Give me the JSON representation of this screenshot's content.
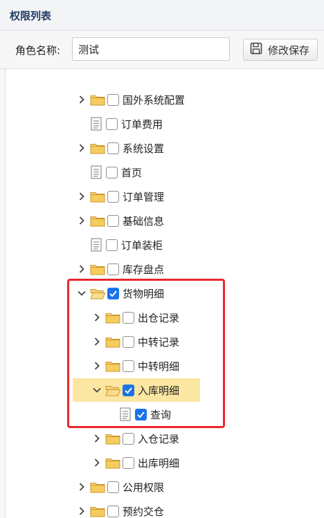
{
  "panel": {
    "title": "权限列表"
  },
  "toolbar": {
    "role_label": "角色名称:",
    "role_value": "测试",
    "save_label": "修改保存"
  },
  "tree": [
    {
      "label": "国外系统配置",
      "kind": "folder",
      "expanded": false,
      "checked": false,
      "level": 0
    },
    {
      "label": "订单费用",
      "kind": "doc",
      "checked": false,
      "level": 0
    },
    {
      "label": "系统设置",
      "kind": "folder",
      "expanded": false,
      "checked": false,
      "level": 0
    },
    {
      "label": "首页",
      "kind": "doc",
      "checked": false,
      "level": 0
    },
    {
      "label": "订单管理",
      "kind": "folder",
      "expanded": false,
      "checked": false,
      "level": 0
    },
    {
      "label": "基础信息",
      "kind": "folder",
      "expanded": false,
      "checked": false,
      "level": 0
    },
    {
      "label": "订单装柜",
      "kind": "doc",
      "checked": false,
      "level": 0
    },
    {
      "label": "库存盘点",
      "kind": "folder",
      "expanded": false,
      "checked": false,
      "level": 0
    },
    {
      "label": "货物明细",
      "kind": "folder",
      "expanded": true,
      "checked": true,
      "level": 0
    },
    {
      "label": "出仓记录",
      "kind": "folder",
      "expanded": false,
      "checked": false,
      "level": 1
    },
    {
      "label": "中转记录",
      "kind": "folder",
      "expanded": false,
      "checked": false,
      "level": 1
    },
    {
      "label": "中转明细",
      "kind": "folder",
      "expanded": false,
      "checked": false,
      "level": 1
    },
    {
      "label": "入库明细",
      "kind": "folder",
      "expanded": true,
      "checked": true,
      "level": 1,
      "selected": true
    },
    {
      "label": "查询",
      "kind": "doc",
      "checked": true,
      "level": 2
    },
    {
      "label": "入仓记录",
      "kind": "folder",
      "expanded": false,
      "checked": false,
      "level": 1
    },
    {
      "label": "出库明细",
      "kind": "folder",
      "expanded": false,
      "checked": false,
      "level": 1
    },
    {
      "label": "公用权限",
      "kind": "folder",
      "expanded": false,
      "checked": false,
      "level": 0
    },
    {
      "label": "预约交仓",
      "kind": "folder",
      "expanded": false,
      "checked": false,
      "level": 0
    }
  ],
  "colors": {
    "highlight": "#e8282e",
    "selected": "#fbe6a2",
    "checkbox": "#1a73e8",
    "folder": "#f2c14e"
  },
  "icons": {
    "collapsed": "chevron-right-icon",
    "expanded": "chevron-down-icon",
    "folder": "folder-icon",
    "folder_open": "folder-open-icon",
    "doc": "document-icon",
    "save": "floppy-disk-icon"
  }
}
